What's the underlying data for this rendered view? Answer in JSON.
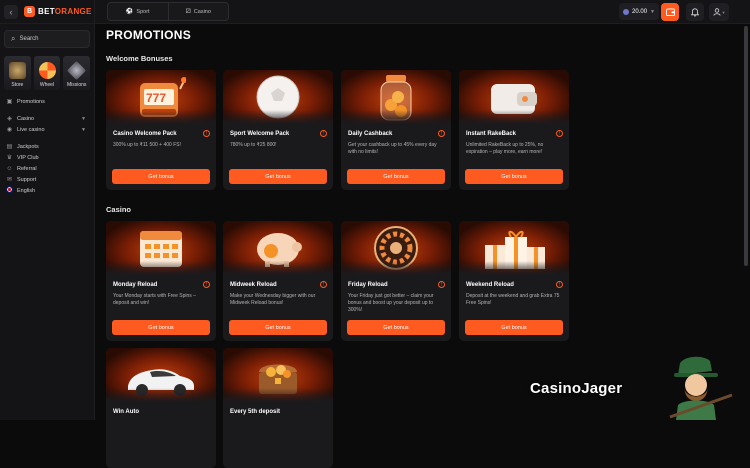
{
  "sidebar": {
    "logo_mark": "B",
    "logo_prefix": "BET",
    "logo_suffix": "ORANGE",
    "search_placeholder": "Search",
    "tiles": [
      {
        "label": "Store",
        "icon": "store-icon"
      },
      {
        "label": "Wheel",
        "icon": "wheel-icon"
      },
      {
        "label": "Missions",
        "icon": "missions-icon"
      }
    ],
    "items": [
      {
        "label": "Promotions",
        "icon": "gift-icon"
      },
      {
        "label": "Casino",
        "icon": "casino-icon"
      },
      {
        "label": "Live casino",
        "icon": "live-icon"
      },
      {
        "label": "Jackpots",
        "icon": "jackpot-icon"
      },
      {
        "label": "VIP Club",
        "icon": "crown-icon"
      },
      {
        "label": "Referral",
        "icon": "users-icon"
      },
      {
        "label": "Support",
        "icon": "chat-icon"
      },
      {
        "label": "English",
        "icon": "uk-flag-icon"
      }
    ]
  },
  "topbar": {
    "tabs": [
      {
        "label": "Sport",
        "icon": "ball-icon"
      },
      {
        "label": "Casino",
        "icon": "dice-icon"
      }
    ],
    "balance": "20.00",
    "colors": {
      "accent": "#ff5a1f"
    }
  },
  "main": {
    "title": "PROMOTIONS",
    "sections": [
      {
        "title": "Welcome Bonuses",
        "cards": [
          {
            "title": "Casino Welcome Pack",
            "desc": "300% up to ₹11 500 + 400 FS!",
            "button": "Get bonus",
            "art": "slot-machine"
          },
          {
            "title": "Sport Welcome Pack",
            "desc": "780% up to ₹25 800!",
            "button": "Get bonus",
            "art": "football"
          },
          {
            "title": "Daily Cashback",
            "desc": "Get your cashback up to 45% every day with no limits!",
            "button": "Get bonus",
            "art": "coin-jar"
          },
          {
            "title": "Instant RakeBack",
            "desc": "Unlimited RakeBack up to 25%, no expiration – play more, earn more!",
            "button": "Get bonus",
            "art": "wallet"
          }
        ]
      },
      {
        "title": "Casino",
        "cards": [
          {
            "title": "Monday Reload",
            "desc": "Your Monday starts with Free Spins – deposit and win!",
            "button": "Get bonus",
            "art": "calendar"
          },
          {
            "title": "Midweek Reload",
            "desc": "Make your Wednesday bigger with our Midweek Reload bonus!",
            "button": "Get bonus",
            "art": "piggy-bank"
          },
          {
            "title": "Friday Reload",
            "desc": "Your Friday just got better – claim your bonus and boost up your deposit up to 300%!",
            "button": "Get bonus",
            "art": "roulette"
          },
          {
            "title": "Weekend Reload",
            "desc": "Deposit at the weekend and grab Extra 75 Free Spins!",
            "button": "Get bonus",
            "art": "gift-boxes"
          },
          {
            "title": "Win Auto",
            "desc": "",
            "button": "",
            "art": "car"
          },
          {
            "title": "Every 5th deposit",
            "desc": "",
            "button": "",
            "art": "treasure-chest"
          }
        ]
      }
    ]
  },
  "watermark": "CasinoJager"
}
